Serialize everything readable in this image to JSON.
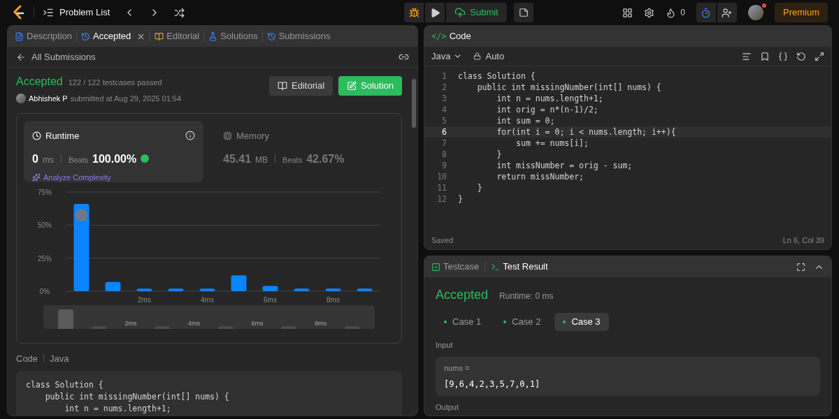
{
  "topbar": {
    "title": "Problem List",
    "submit": "Submit",
    "streak": "0",
    "premium": "Premium",
    "notification_dot": true
  },
  "left_tabs": [
    {
      "label": "Description",
      "selected": false,
      "closable": false
    },
    {
      "label": "Accepted",
      "selected": true,
      "closable": true
    },
    {
      "label": "Editorial",
      "selected": false,
      "closable": false
    },
    {
      "label": "Solutions",
      "selected": false,
      "closable": false
    },
    {
      "label": "Submissions",
      "selected": false,
      "closable": false
    }
  ],
  "back_link": "All Submissions",
  "submission": {
    "status": "Accepted",
    "passed": "122 / 122 testcases passed",
    "user": "Abhishek P",
    "submitted": "submitted at Aug 29, 2025 01:54",
    "buttons": [
      {
        "label": "Editorial",
        "kind": "secondary"
      },
      {
        "label": "Solution",
        "kind": "primary"
      }
    ]
  },
  "runtime": {
    "title": "Runtime",
    "value": "0",
    "unit": "ms",
    "beats_label": "Beats",
    "beats": "100.00%",
    "analyze": "Analyze Complexity",
    "selected": true
  },
  "memory": {
    "title": "Memory",
    "value": "45.41",
    "unit": "MB",
    "beats_label": "Beats",
    "beats": "42.67%",
    "selected": false
  },
  "chart_data": {
    "type": "bar",
    "x": [
      0,
      1,
      2,
      3,
      4,
      5,
      6,
      7,
      8,
      9
    ],
    "xlim": [
      -0.5,
      9.5
    ],
    "values": [
      66,
      7,
      2,
      2,
      2,
      12,
      4,
      2,
      2,
      2
    ],
    "ylim": [
      0,
      75
    ],
    "yticks": [
      {
        "value": 0,
        "label": "0%"
      },
      {
        "value": 25,
        "label": "25%"
      },
      {
        "value": 50,
        "label": "50%"
      },
      {
        "value": 75,
        "label": "75%"
      }
    ],
    "xticks": [
      {
        "value": 2,
        "label": "2ms"
      },
      {
        "value": 4,
        "label": "4ms"
      },
      {
        "value": 6,
        "label": "6ms"
      },
      {
        "value": 8,
        "label": "8ms"
      }
    ]
  },
  "overview_labels": [
    "2ms",
    "4ms",
    "6ms",
    "8ms"
  ],
  "code_header": {
    "label": "Code",
    "language": "Java"
  },
  "submitted_code": [
    "class Solution {",
    "    public int missingNumber(int[] nums) {",
    "        int n = nums.length+1;"
  ],
  "editor": {
    "icon_text": "</>",
    "title": "Code",
    "language": "Java",
    "mode": "Auto",
    "status": "Saved",
    "position": "Ln 6, Col 39",
    "lines": [
      {
        "no": "1",
        "text": "class Solution {",
        "current": false
      },
      {
        "no": "2",
        "text": "    public int missingNumber(int[] nums) {",
        "current": false
      },
      {
        "no": "3",
        "text": "        int n = nums.length+1;",
        "current": false
      },
      {
        "no": "4",
        "text": "        int orig = n*(n-1)/2;",
        "current": false
      },
      {
        "no": "5",
        "text": "        int sum = 0;",
        "current": false
      },
      {
        "no": "6",
        "text": "        for(int i = 0; i < nums.length; i++){",
        "current": true
      },
      {
        "no": "7",
        "text": "            sum += nums[i];",
        "current": false
      },
      {
        "no": "8",
        "text": "        }",
        "current": false
      },
      {
        "no": "9",
        "text": "        int missNumber = orig - sum;",
        "current": false
      },
      {
        "no": "10",
        "text": "        return missNumber;",
        "current": false
      },
      {
        "no": "11",
        "text": "    }",
        "current": false
      },
      {
        "no": "12",
        "text": "}",
        "current": false
      }
    ]
  },
  "bottom_tabs": [
    {
      "label": "Testcase",
      "selected": false
    },
    {
      "label": "Test Result",
      "selected": true
    }
  ],
  "result": {
    "status": "Accepted",
    "runtime": "Runtime: 0 ms",
    "cases": [
      {
        "label": "Case 1",
        "selected": false,
        "color": "#2cbb5d"
      },
      {
        "label": "Case 2",
        "selected": false,
        "color": "#2cbb5d"
      },
      {
        "label": "Case 3",
        "selected": true,
        "color": "#2cbb5d"
      }
    ],
    "input_label": "Input",
    "param": "nums =",
    "value": "[9,6,4,2,3,5,7,0,1]",
    "next_label": "Output"
  }
}
